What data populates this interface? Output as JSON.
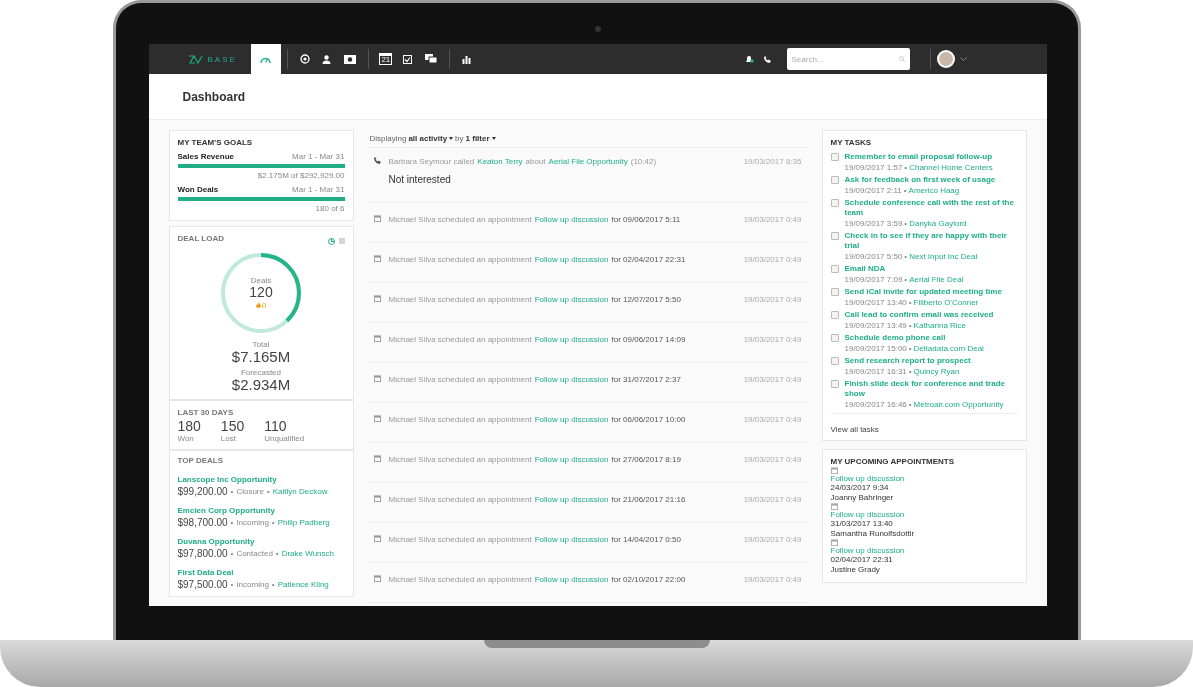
{
  "nav": {
    "logo": "BASE",
    "items": [
      {
        "kind": "gauge",
        "selected": true
      },
      {
        "kind": "target",
        "selected": false
      },
      {
        "kind": "person",
        "selected": false
      },
      {
        "kind": "dollar",
        "selected": false
      },
      {
        "kind": "calendar",
        "label": "21",
        "selected": false
      },
      {
        "kind": "checkbox",
        "selected": false
      },
      {
        "kind": "chat",
        "selected": false
      },
      {
        "kind": "chart",
        "selected": false
      }
    ],
    "search": {
      "placeholder": "Search..."
    }
  },
  "page_title": "Dashboard",
  "goals": {
    "title": "MY TEAM'S GOALS",
    "items": [
      {
        "name": "Sales Revenue",
        "range": "Mar 1 - Mar 31",
        "level": 1,
        "summary": "$2.175M of $292,929.00"
      },
      {
        "name": "Won Deals",
        "range": "Mar 1 - Mar 31",
        "level": 1,
        "summary": "180 of 6"
      }
    ]
  },
  "deal_load": {
    "title": "DEAL LOAD",
    "center_label": "Deals",
    "count": "120",
    "hot": "0",
    "total_label": "Total",
    "total": "$7.165M",
    "forecast_label": "Forecasted",
    "forecast": "$2.934M"
  },
  "last_30_days": {
    "title": "LAST 30 DAYS",
    "stats": [
      {
        "value": "180",
        "label": "Won"
      },
      {
        "value": "150",
        "label": "Lost"
      },
      {
        "value": "110",
        "label": "Unqualified"
      }
    ]
  },
  "top_deals": {
    "title": "TOP DEALS",
    "separator": "•",
    "items": [
      {
        "name": "Lanscope Inc Opportunity",
        "amount": "$99,200.00",
        "stage": "Closure",
        "owner": "Kaitlyn Deckow"
      },
      {
        "name": "Emcien Corp Opportunity",
        "amount": "$98,700.00",
        "stage": "Incoming",
        "owner": "Philip Padberg"
      },
      {
        "name": "Duvana Opportunity",
        "amount": "$97,800.00",
        "stage": "Contacted",
        "owner": "Drake Wunsch"
      },
      {
        "name": "First Data Deal",
        "amount": "$97,500.00",
        "stage": "Incoming",
        "owner": "Patience Kling"
      }
    ]
  },
  "activity": {
    "filter": {
      "prefix": "Displaying",
      "scope": "all activity",
      "joiner": "by",
      "filters": "1 filter"
    },
    "items": [
      {
        "kind": "call",
        "text": "Barbara Seymour called",
        "contact": "Keaton Terry",
        "joiner": "about",
        "link": "Aerial File Opportunity",
        "suffix": "(10:42)",
        "note": "Not interested",
        "time": "19/03/2017 8:35"
      },
      {
        "kind": "appointment",
        "text": "Michael Silva scheduled an appointment",
        "link": "Follow up discussion",
        "suffix": "for 09/06/2017 5:11",
        "time": "19/03/2017 0:49"
      },
      {
        "kind": "appointment",
        "text": "Michael Silva scheduled an appointment",
        "link": "Follow up discussion",
        "suffix": "for 02/04/2017 22:31",
        "time": "19/03/2017 0:49"
      },
      {
        "kind": "appointment",
        "text": "Michael Silva scheduled an appointment",
        "link": "Follow up discussion",
        "suffix": "for 12/07/2017 5:50",
        "time": "19/03/2017 0:49"
      },
      {
        "kind": "appointment",
        "text": "Michael Silva scheduled an appointment",
        "link": "Follow up discussion",
        "suffix": "for 09/06/2017 14:09",
        "time": "19/03/2017 0:49"
      },
      {
        "kind": "appointment",
        "text": "Michael Silva scheduled an appointment",
        "link": "Follow up discussion",
        "suffix": "for 31/07/2017 2:37",
        "time": "19/03/2017 0:49"
      },
      {
        "kind": "appointment",
        "text": "Michael Silva scheduled an appointment",
        "link": "Follow up discussion",
        "suffix": "for 06/06/2017 10:00",
        "time": "19/03/2017 0:49"
      },
      {
        "kind": "appointment",
        "text": "Michael Silva scheduled an appointment",
        "link": "Follow up discussion",
        "suffix": "for 27/06/2017 8:19",
        "time": "19/03/2017 0:49"
      },
      {
        "kind": "appointment",
        "text": "Michael Silva scheduled an appointment",
        "link": "Follow up discussion",
        "suffix": "for 21/06/2017 21:16",
        "time": "19/03/2017 0:49"
      },
      {
        "kind": "appointment",
        "text": "Michael Silva scheduled an appointment",
        "link": "Follow up discussion",
        "suffix": "for 14/04/2017 0:50",
        "time": "19/03/2017 0:49"
      },
      {
        "kind": "appointment",
        "text": "Michael Silva scheduled an appointment",
        "link": "Follow up discussion",
        "suffix": "for 02/10/2017 22:00",
        "time": "19/03/2017 0:49"
      }
    ]
  },
  "tasks": {
    "title": "MY TASKS",
    "separator": "•",
    "items": [
      {
        "title": "Remember to email proposal follow-up",
        "time": "19/09/2017 1:57",
        "related": "Channel Home Centers",
        "checked": false
      },
      {
        "title": "Ask for feedback on first week of usage",
        "time": "19/09/2017 2:11",
        "related": "Americo Haag",
        "checked": false
      },
      {
        "title": "Schedule conference call with the rest of the team",
        "time": "19/09/2017 3:59",
        "related": "Danyka Gaylord",
        "checked": false
      },
      {
        "title": "Check in to see if they are happy with their trial",
        "time": "19/09/2017 5:50",
        "related": "Next Input Inc Deal",
        "checked": false
      },
      {
        "title": "Email NDA",
        "time": "19/09/2017 7:09",
        "related": "Aerial File Deal",
        "checked": false
      },
      {
        "title": "Send iCal invite for updated meeting time",
        "time": "19/09/2017 13:40",
        "related": "Filiberto O'Conner",
        "checked": false
      },
      {
        "title": "Call lead to confirm email was received",
        "time": "19/09/2017 13:49",
        "related": "Katharina Rice",
        "checked": false
      },
      {
        "title": "Schedule demo phone call",
        "time": "19/09/2017 15:00",
        "related": "Deltadata.com Deal",
        "checked": false
      },
      {
        "title": "Send research report to prospect",
        "time": "19/09/2017 16:31",
        "related": "Quincy Ryan",
        "checked": false
      },
      {
        "title": "Finish slide deck for conference and trade show",
        "time": "19/09/2017 16:46",
        "related": "Metroair.com Opportunity",
        "checked": false
      }
    ],
    "footer": "View all tasks"
  },
  "appointments": {
    "title": "MY UPCOMING APPOINTMENTS",
    "items": [
      {
        "title": "Follow up discussion",
        "time": "24/03/2017 9:34",
        "person": "Joanny Bahringer"
      },
      {
        "title": "Follow up discussion",
        "time": "31/03/2017 13:40",
        "person": "Samantha Runolfsdottir"
      },
      {
        "title": "Follow up discussion",
        "time": "02/04/2017 22:31",
        "person": "Justine Grady"
      }
    ]
  }
}
